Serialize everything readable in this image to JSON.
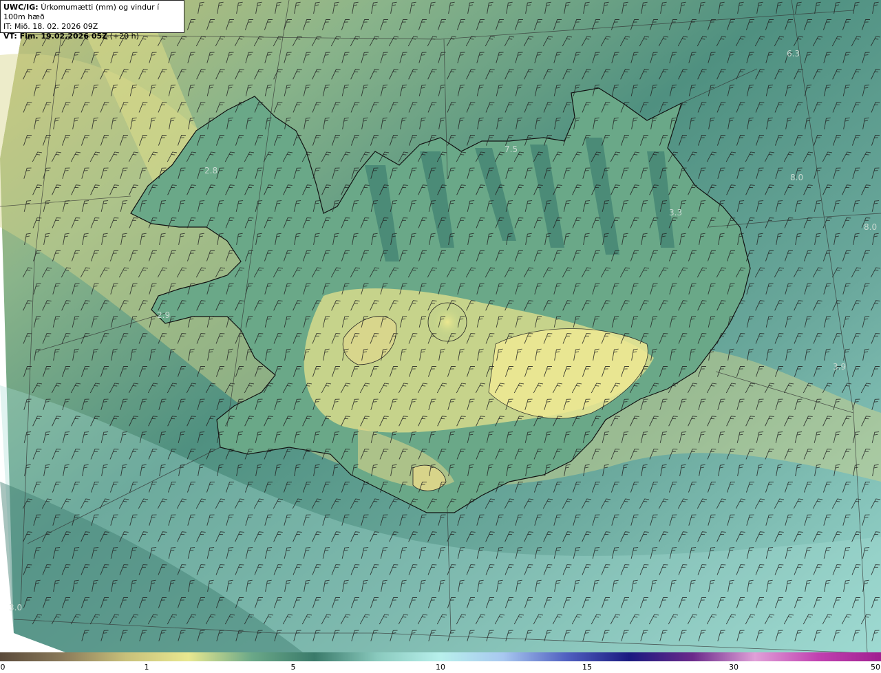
{
  "header": {
    "model_label": "UWC/IG:",
    "title": "Úrkomumætti (mm) og vindur í 100m hæð",
    "initial_time": "IT: Mið. 18. 02. 2026 09Z",
    "valid_time_label": "VT: Fim. 19.02.2026 05Z",
    "lead_time": "(+20 h)"
  },
  "colorbar": {
    "ticks": [
      "0",
      "1",
      "5",
      "10",
      "15",
      "30",
      "50"
    ],
    "colors": [
      "#5a4a3a",
      "#8a7a5a",
      "#c8c07a",
      "#e8e890",
      "#6aa888",
      "#3a7a6a",
      "#8acabe",
      "#b8f0ec",
      "#a8c8f0",
      "#5060c0",
      "#1a1a80",
      "#6a2a8a",
      "#e0a0d8",
      "#c040b0",
      "#a02090"
    ]
  },
  "map_labels": [
    {
      "text": "6.3"
    },
    {
      "text": "7.5"
    },
    {
      "text": "2.8"
    },
    {
      "text": "8.0"
    },
    {
      "text": "3.3"
    },
    {
      "text": "2.9"
    },
    {
      "text": "3.9"
    },
    {
      "text": "3.0"
    },
    {
      "text": "8.0"
    }
  ],
  "colors": {
    "ocean_dark": "#4a8a7a",
    "ocean_light": "#9ad6cc",
    "land_high": "#e2e08a",
    "land_mid": "#7ab08a",
    "coast": "#111111",
    "barb": "#222222"
  }
}
